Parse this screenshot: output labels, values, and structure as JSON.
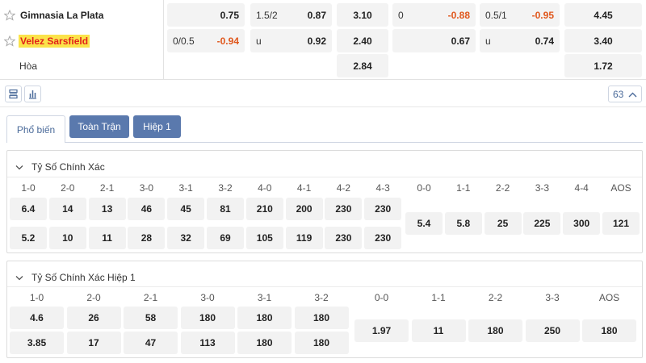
{
  "match": {
    "teams": [
      {
        "name": "Gimnasia La Plata",
        "highlighted": false
      },
      {
        "name": "Velez Sarsfield",
        "highlighted": true
      },
      {
        "name": "Hòa",
        "highlighted": false
      }
    ],
    "rows": [
      {
        "handicap": {
          "line": "",
          "odds": "0.75"
        },
        "over_under": {
          "line": "1.5/2",
          "odds": "0.87"
        },
        "x12": "3.10",
        "ht_handicap": {
          "line": "0",
          "odds": "-0.88"
        },
        "ht_over_under": {
          "line": "0.5/1",
          "odds": "-0.95"
        },
        "ht_x12": "4.45"
      },
      {
        "handicap": {
          "line": "0/0.5",
          "odds": "-0.94"
        },
        "over_under": {
          "line": "u",
          "odds": "0.92"
        },
        "x12": "2.40",
        "ht_handicap": {
          "line": "",
          "odds": "0.67"
        },
        "ht_over_under": {
          "line": "u",
          "odds": "0.74"
        },
        "ht_x12": "3.40"
      },
      {
        "x12": "2.84",
        "ht_x12": "1.72"
      }
    ]
  },
  "toolbar": {
    "count": "63",
    "icons": [
      "list-icon",
      "bar-chart-icon",
      "chevron-up-icon"
    ]
  },
  "tabs": [
    {
      "label": "Phổ biến",
      "active": true
    },
    {
      "label": "Toàn Trận",
      "active": false
    },
    {
      "label": "Hiệp 1",
      "active": false
    }
  ],
  "sections": [
    {
      "title": "Tỷ Số Chính Xác",
      "home_scores": [
        "1-0",
        "2-0",
        "2-1",
        "3-0",
        "3-1",
        "3-2",
        "4-0",
        "4-1",
        "4-2",
        "4-3"
      ],
      "home_odds": [
        "6.4",
        "14",
        "13",
        "46",
        "45",
        "81",
        "210",
        "200",
        "230",
        "230"
      ],
      "away_odds": [
        "5.2",
        "10",
        "11",
        "28",
        "32",
        "69",
        "105",
        "119",
        "230",
        "230"
      ],
      "draw_scores": [
        "0-0",
        "1-1",
        "2-2",
        "3-3",
        "4-4",
        "AOS"
      ],
      "draw_odds": [
        "5.4",
        "5.8",
        "25",
        "225",
        "300",
        "121"
      ]
    },
    {
      "title": "Tỷ Số Chính Xác Hiệp 1",
      "home_scores": [
        "1-0",
        "2-0",
        "2-1",
        "3-0",
        "3-1",
        "3-2"
      ],
      "home_odds": [
        "4.6",
        "26",
        "58",
        "180",
        "180",
        "180"
      ],
      "away_odds": [
        "3.85",
        "17",
        "47",
        "113",
        "180",
        "180"
      ],
      "draw_scores": [
        "0-0",
        "1-1",
        "2-2",
        "3-3",
        "AOS"
      ],
      "draw_odds": [
        "1.97",
        "11",
        "180",
        "250",
        "180"
      ]
    }
  ],
  "colors": {
    "accent": "#5a79ad",
    "negative_odds": "#e0571c",
    "highlight_bg": "#fbe34a",
    "highlight_text": "#e2231a"
  }
}
